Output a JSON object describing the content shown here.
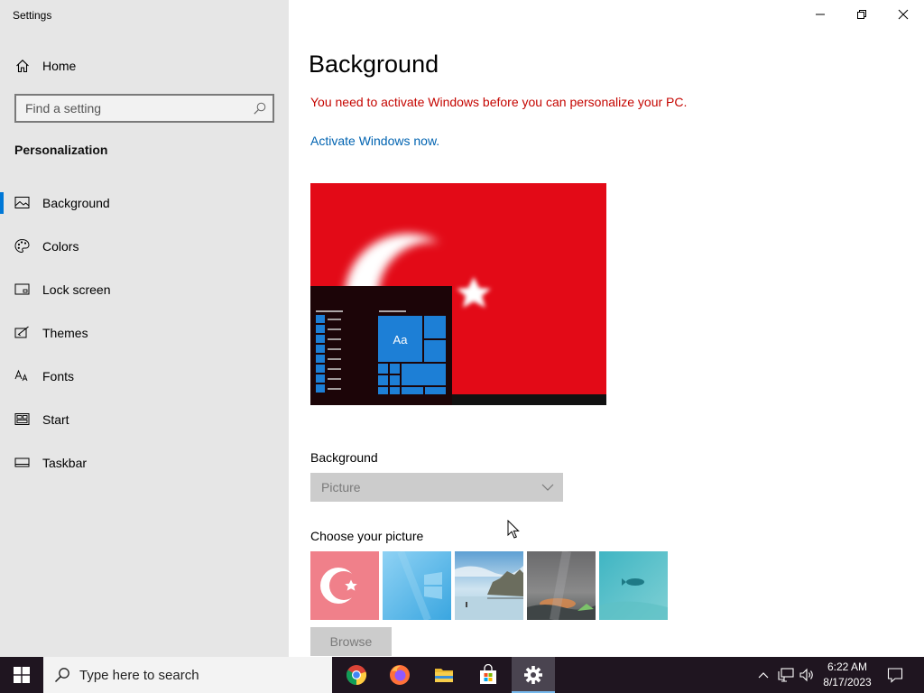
{
  "window": {
    "title": "Settings",
    "minimize_icon": "minimize-icon",
    "restore_icon": "restore-icon",
    "close_icon": "close-icon"
  },
  "sidebar": {
    "home_label": "Home",
    "search_placeholder": "Find a setting",
    "section_title": "Personalization",
    "items": [
      {
        "label": "Background",
        "icon": "picture-icon",
        "active": true
      },
      {
        "label": "Colors",
        "icon": "palette-icon",
        "active": false
      },
      {
        "label": "Lock screen",
        "icon": "lock-screen-icon",
        "active": false
      },
      {
        "label": "Themes",
        "icon": "themes-icon",
        "active": false
      },
      {
        "label": "Fonts",
        "icon": "fonts-icon",
        "active": false
      },
      {
        "label": "Start",
        "icon": "start-icon",
        "active": false
      },
      {
        "label": "Taskbar",
        "icon": "taskbar-icon",
        "active": false
      }
    ]
  },
  "main": {
    "title": "Background",
    "activation_warning": "You need to activate Windows before you can personalize your PC.",
    "activate_link": "Activate Windows now.",
    "preview_tile_text": "Aa",
    "background_label": "Background",
    "background_value": "Picture",
    "choose_label": "Choose your picture",
    "browse_label": "Browse"
  },
  "taskbar": {
    "search_placeholder": "Type here to search",
    "time": "6:22 AM",
    "date": "8/17/2023",
    "apps": [
      "chrome-icon",
      "firefox-icon",
      "file-explorer-icon",
      "store-icon",
      "settings-icon"
    ]
  },
  "colors": {
    "accent": "#0078d7",
    "warning": "#c50500",
    "link": "#0063b1",
    "flag_red": "#e30a17",
    "sidebar_bg": "#e6e6e6",
    "taskbar_bg": "#1f1520"
  }
}
